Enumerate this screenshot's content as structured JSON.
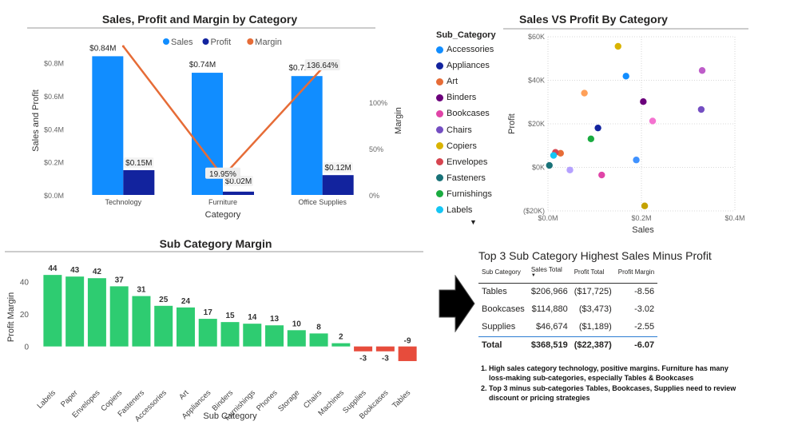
{
  "chart_data": [
    {
      "type": "bar",
      "title": "Sales, Profit and Margin by Category",
      "categories": [
        "Technology",
        "Furniture",
        "Office Supplies"
      ],
      "series": [
        {
          "name": "Sales",
          "values": [
            0.84,
            0.74,
            0.72
          ],
          "labels": [
            "$0.84M",
            "$0.74M",
            "$0.72M"
          ],
          "color": "#118DFF"
        },
        {
          "name": "Profit",
          "values": [
            0.15,
            0.02,
            0.12
          ],
          "labels": [
            "$0.15M",
            "$0.02M",
            "$0.12M"
          ],
          "color": "#12239E"
        },
        {
          "name": "Margin",
          "type": "line",
          "axis": "secondary",
          "values": [
            160,
            19.95,
            136.64
          ],
          "labels": [
            "",
            "19.95%",
            "136.64%"
          ],
          "color": "#E66C37"
        }
      ],
      "xlabel": "Category",
      "ylabel": "Sales and Profit",
      "y2label": "Margin",
      "ylim": [
        0,
        0.9
      ],
      "y2lim": [
        0,
        160
      ],
      "yticks": [
        "$0.0M",
        "$0.2M",
        "$0.4M",
        "$0.6M",
        "$0.8M"
      ],
      "yticks_values": [
        0,
        0.2,
        0.4,
        0.6,
        0.8
      ],
      "y2ticks": [
        "0%",
        "50%",
        "100%"
      ],
      "y2ticks_values": [
        0,
        50,
        100
      ],
      "legend": "top-center",
      "grid": false
    },
    {
      "type": "scatter",
      "title": "Sales VS Profit By Category",
      "xlabel": "Sales",
      "ylabel": "Profit",
      "xlim": [
        0,
        0.4
      ],
      "ylim": [
        -20,
        60
      ],
      "xticks": [
        "$0.0M",
        "$0.2M",
        "$0.4M"
      ],
      "xticks_values": [
        0,
        0.2,
        0.4
      ],
      "yticks": [
        "($20K)",
        "$0K",
        "$20K",
        "$40K",
        "$60K"
      ],
      "yticks_values": [
        -20,
        0,
        20,
        40,
        60
      ],
      "grid": true,
      "legend": "left",
      "legend_title": "Sub_Category",
      "points": [
        {
          "name": "Accessories",
          "x": 0.167,
          "y": 41.9,
          "color": "#118DFF"
        },
        {
          "name": "Appliances",
          "x": 0.107,
          "y": 18.1,
          "color": "#12239E"
        },
        {
          "name": "Art",
          "x": 0.027,
          "y": 6.5,
          "color": "#E66C37"
        },
        {
          "name": "Binders",
          "x": 0.204,
          "y": 30.2,
          "color": "#6B007B"
        },
        {
          "name": "Bookcases",
          "x": 0.115,
          "y": -3.5,
          "color": "#E044A7"
        },
        {
          "name": "Chairs",
          "x": 0.328,
          "y": 26.6,
          "color": "#744EC2"
        },
        {
          "name": "Copiers",
          "x": 0.15,
          "y": 55.6,
          "color": "#D9B300"
        },
        {
          "name": "Envelopes",
          "x": 0.016,
          "y": 6.9,
          "color": "#D64550"
        },
        {
          "name": "Fasteners",
          "x": 0.003,
          "y": 0.9,
          "color": "#197278"
        },
        {
          "name": "Furnishings",
          "x": 0.092,
          "y": 13.1,
          "color": "#1AAB40"
        },
        {
          "name": "Labels",
          "x": 0.012,
          "y": 5.5,
          "color": "#15C6F4"
        },
        {
          "name": "Machines",
          "x": 0.189,
          "y": 3.4,
          "color": "#4092FF"
        },
        {
          "name": "Paper",
          "x": 0.078,
          "y": 34.1,
          "color": "#FFA058"
        },
        {
          "name": "Phones",
          "x": 0.33,
          "y": 44.5,
          "color": "#BE5DC9"
        },
        {
          "name": "Storage",
          "x": 0.224,
          "y": 21.3,
          "color": "#F472D0"
        },
        {
          "name": "Supplies",
          "x": 0.047,
          "y": -1.2,
          "color": "#B5A1FF"
        },
        {
          "name": "Tables",
          "x": 0.207,
          "y": -17.7,
          "color": "#C4A200"
        }
      ]
    },
    {
      "type": "bar",
      "title": "Sub Category Margin",
      "xlabel": "Sub Category",
      "ylabel": "Profit Margin",
      "categories": [
        "Labels",
        "Paper",
        "Envelopes",
        "Copiers",
        "Fasteners",
        "Accessories",
        "Art",
        "Appliances",
        "Binders",
        "Furnishings",
        "Phones",
        "Storage",
        "Chairs",
        "Machines",
        "Supplies",
        "Bookcases",
        "Tables"
      ],
      "values": [
        44,
        43,
        42,
        37,
        31,
        25,
        24,
        17,
        15,
        14,
        13,
        10,
        8,
        2,
        -3,
        -3,
        -9
      ],
      "labels": [
        "44",
        "43",
        "42",
        "37",
        "31",
        "25",
        "24",
        "17",
        "15",
        "14",
        "13",
        "10",
        "8",
        "2",
        "-3",
        "-3",
        "-9"
      ],
      "positive_color": "#2ECC71",
      "negative_color": "#E74C3C",
      "ylim": [
        -10,
        48
      ],
      "yticks": [
        "0",
        "20",
        "40"
      ],
      "yticks_values": [
        0,
        20,
        40
      ],
      "grid": false
    }
  ],
  "scatter_legend": {
    "title": "Sub_Category",
    "items": [
      {
        "label": "Accessories",
        "color": "#118DFF"
      },
      {
        "label": "Appliances",
        "color": "#12239E"
      },
      {
        "label": "Art",
        "color": "#E66C37"
      },
      {
        "label": "Binders",
        "color": "#6B007B"
      },
      {
        "label": "Bookcases",
        "color": "#E044A7"
      },
      {
        "label": "Chairs",
        "color": "#744EC2"
      },
      {
        "label": "Copiers",
        "color": "#D9B300"
      },
      {
        "label": "Envelopes",
        "color": "#D64550"
      },
      {
        "label": "Fasteners",
        "color": "#197278"
      },
      {
        "label": "Furnishings",
        "color": "#1AAB40"
      },
      {
        "label": "Labels",
        "color": "#15C6F4"
      }
    ],
    "more_indicator": "▼"
  },
  "table": {
    "title": "Top 3 Sub Category Highest Sales Minus Profit",
    "headers": [
      "Sub Category",
      "Sales Total",
      "Profit Total",
      "Profit Margin"
    ],
    "sort_indicator": "▼",
    "rows": [
      [
        "Tables",
        "$206,966",
        "($17,725)",
        "-8.56"
      ],
      [
        "Bookcases",
        "$114,880",
        "($3,473)",
        "-3.02"
      ],
      [
        "Supplies",
        "$46,674",
        "($1,189)",
        "-2.55"
      ]
    ],
    "total": [
      "Total",
      "$368,519",
      "($22,387)",
      "-6.07"
    ]
  },
  "notes": [
    "High sales category technology, positive margins. Furniture has many loss-making sub-categories, especially Tables & Bookcases",
    "Top 3 minus sub-categories Tables, Bookcases, Supplies need to review discount or pricing strategies"
  ]
}
